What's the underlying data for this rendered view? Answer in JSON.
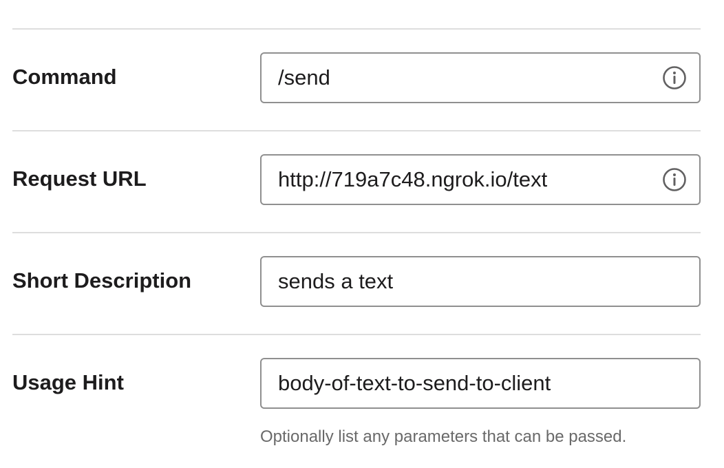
{
  "form": {
    "command": {
      "label": "Command",
      "value": "/send",
      "icon": "info-icon"
    },
    "request_url": {
      "label": "Request URL",
      "value": "http://719a7c48.ngrok.io/text",
      "icon": "info-icon"
    },
    "short_description": {
      "label": "Short Description",
      "value": "sends a text"
    },
    "usage_hint": {
      "label": "Usage Hint",
      "value": "body-of-text-to-send-to-client",
      "helper_text": "Optionally list any parameters that can be passed."
    }
  },
  "colors": {
    "text": "#1d1c1d",
    "border": "#8f8f8f",
    "divider": "#dddddd",
    "helper_text": "#696969",
    "icon": "#616061"
  }
}
